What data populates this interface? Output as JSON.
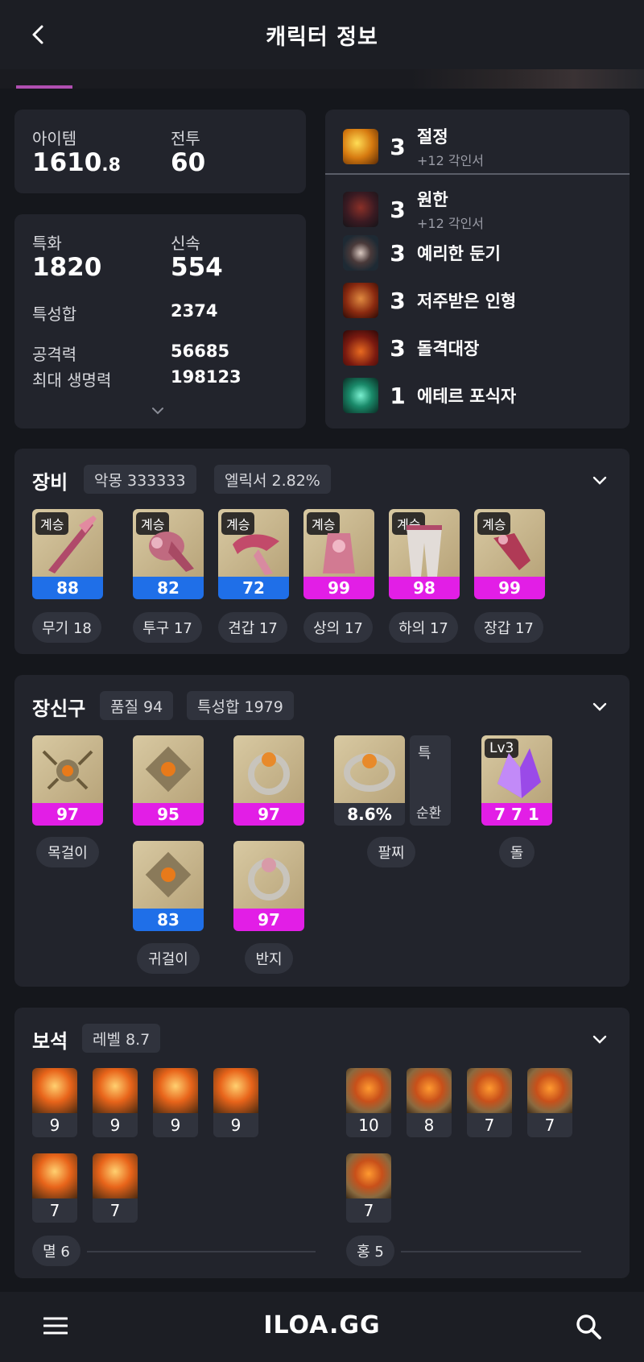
{
  "header": {
    "title": "캐릭터 정보"
  },
  "stats_top": {
    "item_label": "아이템",
    "item_value_int": "1610",
    "item_value_dec": ".8",
    "combat_label": "전투",
    "combat_value": "60"
  },
  "stats": {
    "spec_label": "특화",
    "spec_value": "1820",
    "swift_label": "신속",
    "swift_value": "554",
    "sum_label": "특성합",
    "sum_value": "2374",
    "atk_label": "공격력",
    "atk_value": "56685",
    "hp_label": "최대 생명력",
    "hp_value": "198123"
  },
  "engravings": [
    {
      "level": "3",
      "name": "절정",
      "sub": "+12 각인서",
      "icon": "lightning-icon"
    },
    {
      "level": "3",
      "name": "원한",
      "sub": "+12 각인서",
      "icon": "demon-icon"
    },
    {
      "level": "3",
      "name": "예리한 둔기",
      "sub": "",
      "icon": "mace-icon"
    },
    {
      "level": "3",
      "name": "저주받은 인형",
      "sub": "",
      "icon": "doll-icon"
    },
    {
      "level": "3",
      "name": "돌격대장",
      "sub": "",
      "icon": "charge-icon"
    },
    {
      "level": "1",
      "name": "에테르 포식자",
      "sub": "",
      "icon": "ether-icon"
    }
  ],
  "equipment": {
    "title": "장비",
    "chip1": "악몽 333333",
    "chip2": "엘릭서 2.82%",
    "items": [
      {
        "badge": "계승",
        "value": "88",
        "label": "무기 18",
        "color": "#1f6fe8"
      },
      {
        "badge": "계승",
        "value": "82",
        "label": "투구 17",
        "color": "#1f6fe8"
      },
      {
        "badge": "계승",
        "value": "72",
        "label": "견갑 17",
        "color": "#1f6fe8"
      },
      {
        "badge": "계승",
        "value": "99",
        "label": "상의 17",
        "color": "#e21ee6"
      },
      {
        "badge": "계승",
        "value": "98",
        "label": "하의 17",
        "color": "#e21ee6"
      },
      {
        "badge": "계승",
        "value": "99",
        "label": "장갑 17",
        "color": "#e21ee6"
      }
    ]
  },
  "accessories": {
    "title": "장신구",
    "chip1": "품질 94",
    "chip2": "특성합 1979",
    "necklace": {
      "value": "97",
      "label": "목걸이"
    },
    "earring1": {
      "value": "95"
    },
    "earring2": {
      "value": "83",
      "label": "귀걸이"
    },
    "ring1": {
      "value": "97"
    },
    "ring2": {
      "value": "97",
      "label": "반지"
    },
    "bracelet": {
      "value": "8.6%",
      "label": "팔찌",
      "side_top": "특",
      "side_bottom": "순환"
    },
    "stone": {
      "badge": "Lv3",
      "value": "7 7 1",
      "label": "돌"
    }
  },
  "gems": {
    "title": "보석",
    "chip": "레벨 8.7",
    "left": [
      "9",
      "9",
      "9",
      "9",
      "7",
      "7"
    ],
    "right": [
      "10",
      "8",
      "7",
      "7",
      "7"
    ],
    "left_label": "멸 6",
    "right_label": "홍 5"
  },
  "bottom": {
    "logo": "ILOA.GG"
  }
}
